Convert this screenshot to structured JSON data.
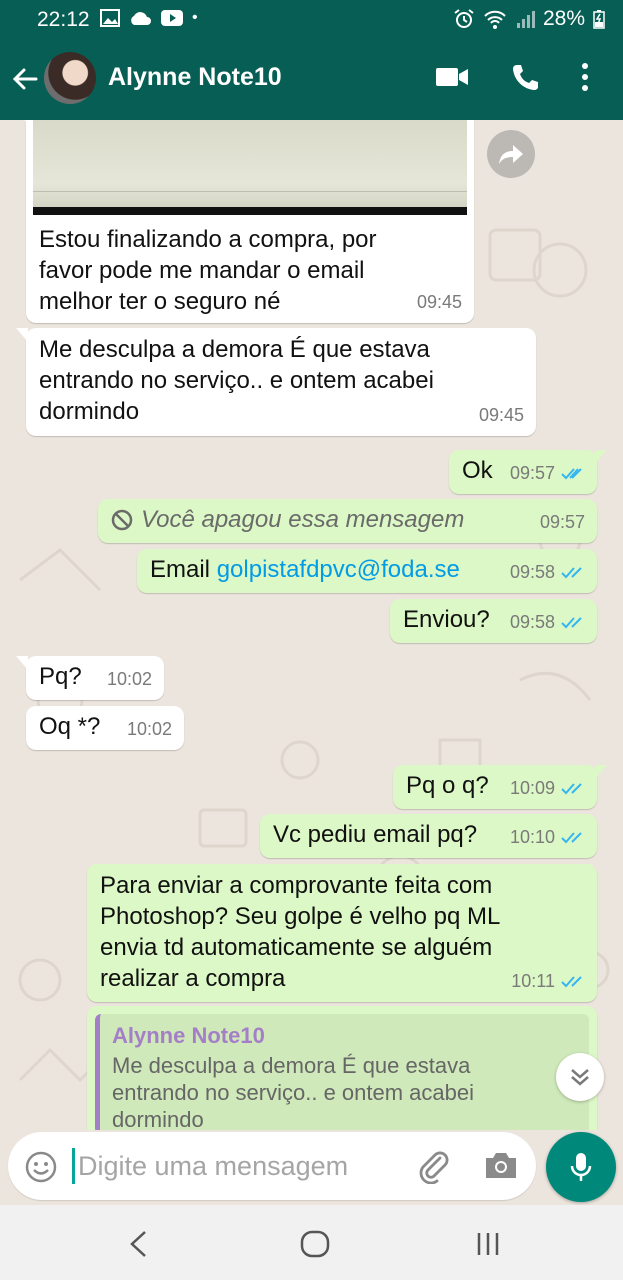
{
  "status": {
    "time": "22:12",
    "battery": "28%",
    "dot": "•"
  },
  "contact": {
    "name": "Alynne Note10"
  },
  "messages": [
    {
      "dir": "in",
      "text": "Estou finalizando a compra, por favor pode me mandar o email melhor ter o seguro né",
      "lines": [
        "Estou finalizando a compra, por",
        "favor pode me mandar o email",
        "melhor ter o seguro né"
      ],
      "time": "09:45"
    },
    {
      "dir": "in",
      "lines": [
        "Me desculpa a demora É que estava",
        "entrando no serviço.. e ontem acabei",
        "dormindo"
      ],
      "time": "09:45"
    },
    {
      "dir": "out",
      "text": "Ok",
      "time": "09:57"
    },
    {
      "dir": "out",
      "text": "Você apagou essa mensagem",
      "time": "09:57",
      "deleted": true
    },
    {
      "dir": "out",
      "text": "Email ",
      "link": "golpistafdpvc@foda.se",
      "time": "09:58"
    },
    {
      "dir": "out",
      "text": "Enviou?",
      "time": "09:58"
    },
    {
      "dir": "in",
      "text": "Pq?",
      "time": "10:02"
    },
    {
      "dir": "in",
      "text": "Oq *?",
      "time": "10:02"
    },
    {
      "dir": "out",
      "text": "Pq o q?",
      "time": "10:09"
    },
    {
      "dir": "out",
      "text": "Vc pediu email pq?",
      "time": "10:10"
    },
    {
      "dir": "out",
      "lines": [
        "Para enviar a comprovante feita com",
        "Photoshop? Seu golpe é velho pq ML",
        "envia td automaticamente se alguém",
        "realizar a compra"
      ],
      "time": "10:11"
    }
  ],
  "quote": {
    "name": "Alynne Note10",
    "lines": [
      "Me desculpa a demora É que estava",
      "entrando no serviço.. e ontem acabei",
      "dormindo"
    ]
  },
  "input": {
    "placeholder": "Digite uma mensagem"
  },
  "colors": {
    "header": "#075e54",
    "outgoing": "#dcf8c6",
    "tick_read": "#34b7f1",
    "accent": "#00897b"
  }
}
